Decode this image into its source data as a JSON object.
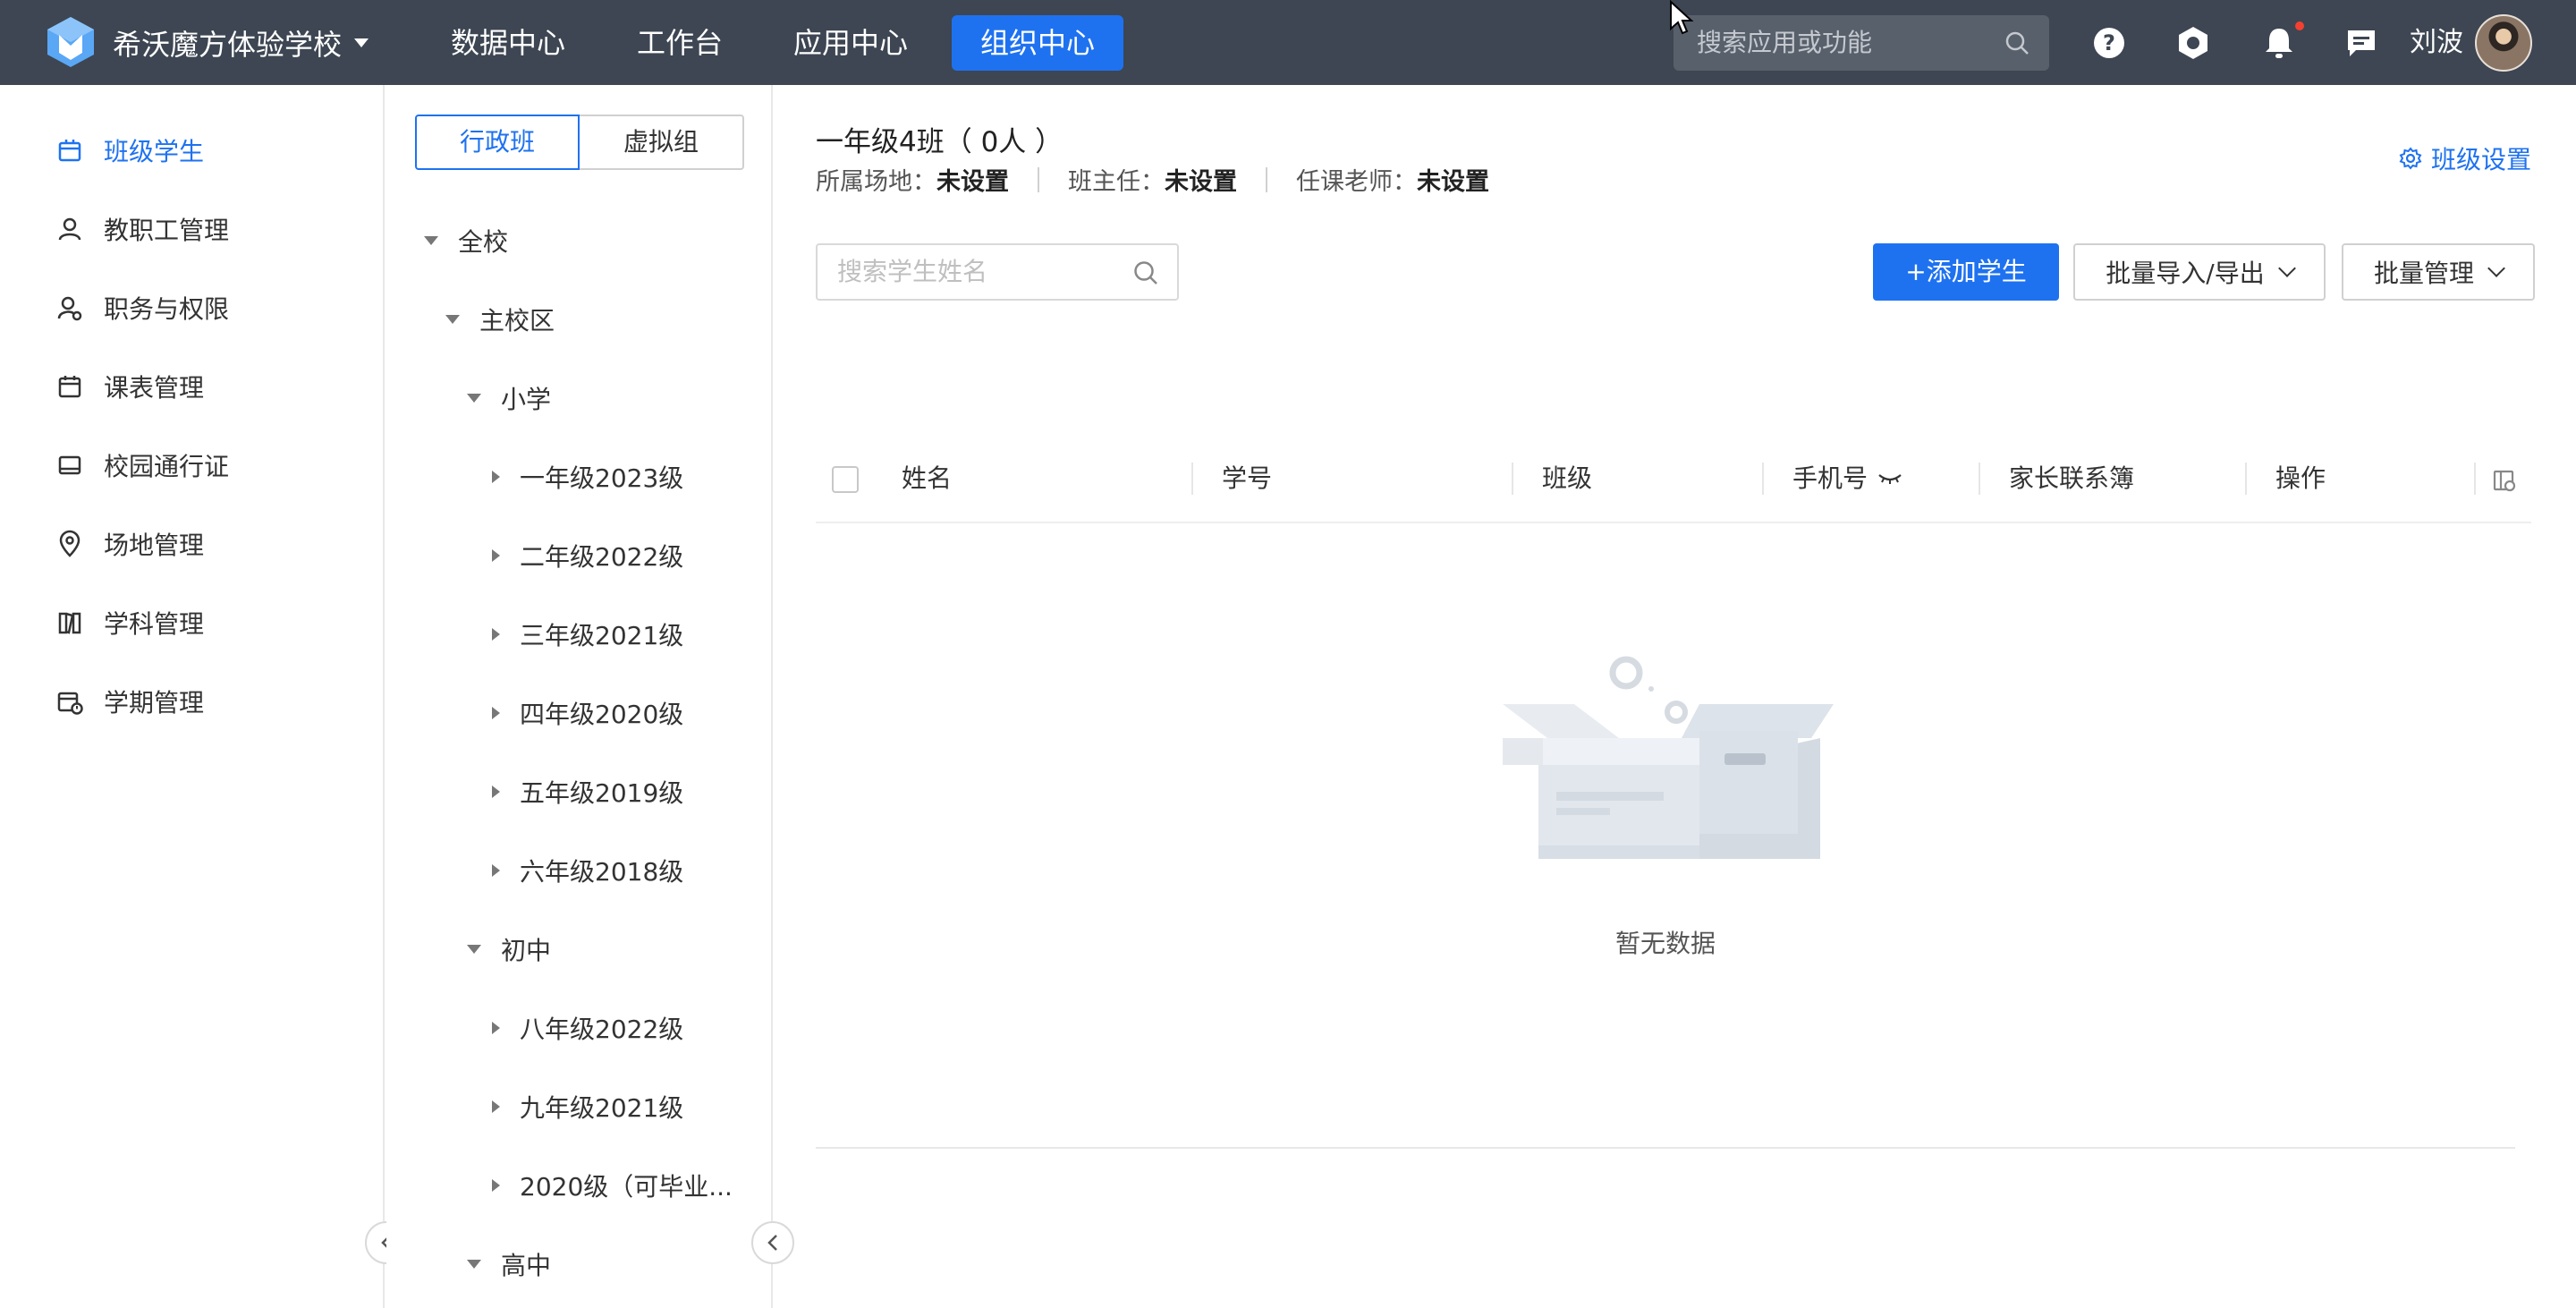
{
  "topbar": {
    "school_name": "希沃魔方体验学校",
    "nav": [
      {
        "label": "数据中心",
        "active": false
      },
      {
        "label": "工作台",
        "active": false
      },
      {
        "label": "应用中心",
        "active": false
      },
      {
        "label": "组织中心",
        "active": true
      }
    ],
    "search_placeholder": "搜索应用或功能",
    "user_name": "刘波",
    "icons": [
      "help-icon",
      "hexagon-settings-icon",
      "bell-icon",
      "message-icon"
    ],
    "accent_color": "#1e72f0"
  },
  "sidebar": {
    "items": [
      {
        "label": "班级学生",
        "icon": "class-icon",
        "active": true
      },
      {
        "label": "教职工管理",
        "icon": "user-icon",
        "active": false
      },
      {
        "label": "职务与权限",
        "icon": "role-icon",
        "active": false
      },
      {
        "label": "课表管理",
        "icon": "calendar-icon",
        "active": false
      },
      {
        "label": "校园通行证",
        "icon": "pass-icon",
        "active": false
      },
      {
        "label": "场地管理",
        "icon": "location-icon",
        "active": false
      },
      {
        "label": "学科管理",
        "icon": "book-icon",
        "active": false
      },
      {
        "label": "学期管理",
        "icon": "term-icon",
        "active": false
      }
    ]
  },
  "tree": {
    "tabs": [
      "行政班",
      "虚拟组"
    ],
    "nodes": [
      {
        "label": "全校",
        "level": 0,
        "expanded": true
      },
      {
        "label": "主校区",
        "level": 1,
        "expanded": true
      },
      {
        "label": "小学",
        "level": 2,
        "expanded": true
      },
      {
        "label": "一年级2023级",
        "level": 3,
        "expanded": false
      },
      {
        "label": "二年级2022级",
        "level": 3,
        "expanded": false
      },
      {
        "label": "三年级2021级",
        "level": 3,
        "expanded": false
      },
      {
        "label": "四年级2020级",
        "level": 3,
        "expanded": false
      },
      {
        "label": "五年级2019级",
        "level": 3,
        "expanded": false
      },
      {
        "label": "六年级2018级",
        "level": 3,
        "expanded": false
      },
      {
        "label": "初中",
        "level": 2,
        "expanded": true
      },
      {
        "label": "八年级2022级",
        "level": 3,
        "expanded": false
      },
      {
        "label": "九年级2021级",
        "level": 3,
        "expanded": false
      },
      {
        "label": "2020级（可毕业...",
        "level": 3,
        "expanded": false
      },
      {
        "label": "高中",
        "level": 2,
        "expanded": true
      }
    ]
  },
  "main": {
    "class_title": "一年级4班（ 0人 ）",
    "meta": {
      "venue_label": "所属场地：",
      "venue_value": "未设置",
      "head_teacher_label": "班主任：",
      "head_teacher_value": "未设置",
      "teachers_label": "任课老师：",
      "teachers_value": "未设置"
    },
    "settings_label": "班级设置",
    "search_placeholder": "搜索学生姓名",
    "add_button": "+添加学生",
    "import_export_button": "批量导入/导出",
    "batch_manage_button": "批量管理",
    "columns": [
      "姓名",
      "学号",
      "班级",
      "手机号",
      "家长联系簿",
      "操作"
    ],
    "rows": [],
    "empty_text": "暂无数据"
  }
}
